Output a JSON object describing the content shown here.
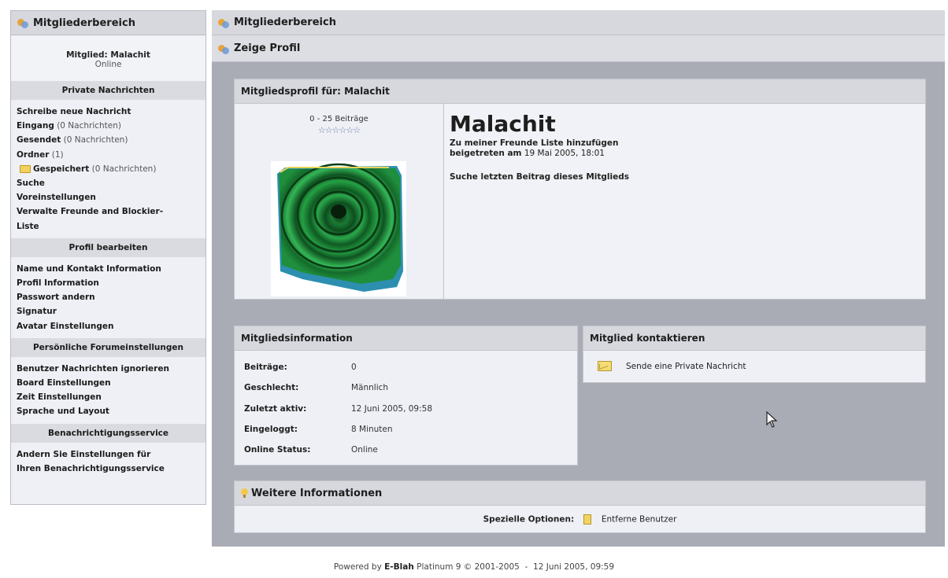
{
  "sidebar": {
    "title": "Mitgliederbereich",
    "member_line": "Mitglied: Malachit",
    "status_line": "Online",
    "sections": {
      "messages": {
        "heading": "Private Nachrichten",
        "write": "Schreibe neue Nachricht",
        "inbox": "Eingang",
        "inbox_count": "(0 Nachrichten)",
        "sent": "Gesendet",
        "sent_count": "(0 Nachrichten)",
        "folders": "Ordner",
        "folders_count": "(1)",
        "saved": "Gespeichert",
        "saved_count": "(0 Nachrichten)",
        "search": "Suche",
        "prefs": "Voreinstellungen",
        "buddies_1": "Verwalte Freunde and Blockier-",
        "buddies_2": "Liste"
      },
      "profile": {
        "heading": "Profil bearbeiten",
        "items": [
          "Name und Kontakt Information",
          "Profil Information",
          "Passwort andern",
          "Signatur",
          "Avatar Einstellungen"
        ]
      },
      "forum": {
        "heading": "Persönliche Forumeinstellungen",
        "items": [
          "Benutzer Nachrichten ignorieren",
          "Board Einstellungen",
          "Zeit Einstellungen",
          "Sprache und Layout"
        ]
      },
      "notify": {
        "heading": "Benachrichtigungsservice",
        "item_1": "Andern Sie Einstellungen für",
        "item_2": "Ihren Benachrichtigungsservice"
      }
    }
  },
  "main": {
    "breadcrumb": "Mitgliederbereich",
    "subtitle": "Zeige Profil",
    "profile": {
      "heading": "Mitgliedsprofil für: Malachit",
      "posts_range": "0 - 25 Beiträge",
      "stars": "☆☆☆☆☆☆",
      "username": "Malachit",
      "add_friend": "Zu meiner Freunde Liste hinzufügen",
      "joined_label": "beigetreten am",
      "joined_value": "19 Mai 2005, 18:01",
      "last_post": "Suche letzten Beitrag dieses Mitglieds"
    },
    "member_info": {
      "heading": "Mitgliedsinformation",
      "rows": [
        {
          "label": "Beiträge:",
          "value": "0"
        },
        {
          "label": "Geschlecht:",
          "value": "Männlich"
        },
        {
          "label": "Zuletzt aktiv:",
          "value": "12 Juni 2005, 09:58"
        },
        {
          "label": "Eingeloggt:",
          "value": "8 Minuten"
        },
        {
          "label": "Online Status:",
          "value": "Online"
        }
      ]
    },
    "contact": {
      "heading": "Mitglied kontaktieren",
      "send_pm": "Sende eine Private Nachricht"
    },
    "more": {
      "heading": "Weitere Informationen",
      "special_label": "Spezielle Optionen:",
      "remove_user": "Entferne Benutzer"
    }
  },
  "footer": {
    "powered_by": "Powered by",
    "product": "E-Blah",
    "version": "Platinum 9 © 2001-2005",
    "separator": "-",
    "date": "12 Juni 2005, 09:59"
  },
  "colors": {
    "header_bg": "#d6d8de",
    "panel_bg": "#eef0f6",
    "main_bg": "#a9acb5",
    "avatar_green": "#1e9a3c"
  }
}
